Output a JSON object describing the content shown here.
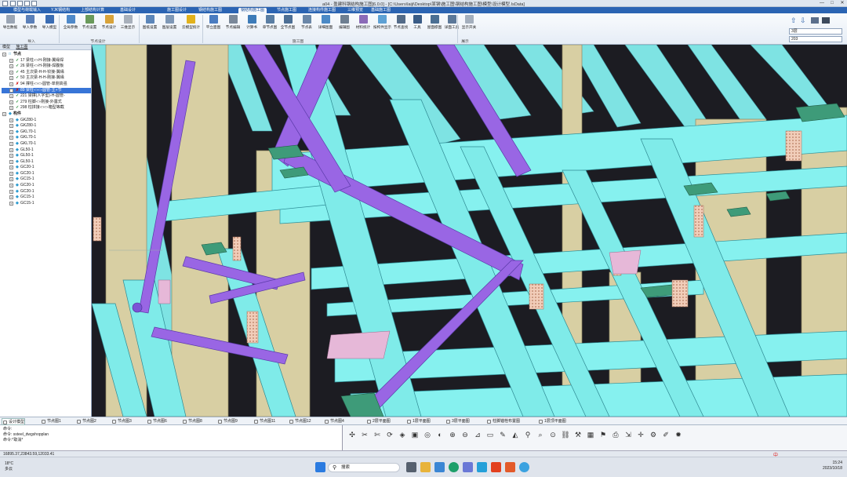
{
  "window": {
    "title": "a04 - 盈建科钢结构施工图[6.0.0] - [C:\\Users\\laiji\\Desktop\\某钢\\施工图\\钢结构施工图\\模型\\设计模型.IsData]",
    "minimize": "—",
    "maximize": "□",
    "close": "✕"
  },
  "ribbon_tabs": [
    "模型与荷载输入",
    "YJK钢结构",
    "上部结构计算",
    "基础设计",
    "施工图设计",
    "钢结构施工图",
    "钢结构施工图",
    "节点施工图",
    "连接构件施工图",
    "三维预览",
    "基础施工图"
  ],
  "active_tab_index": 6,
  "ribbon": {
    "buttons": [
      {
        "label": "导出数据",
        "icon": "export-icon",
        "color": "#9aa5b4"
      },
      {
        "label": "导入参数",
        "icon": "import-params-icon",
        "color": "#5a7fb8"
      },
      {
        "label": "导入模型",
        "icon": "import-model-icon",
        "color": "#3b6db3"
      },
      {
        "label": "全局参数",
        "icon": "global-params-icon",
        "color": "#4f89c9"
      },
      {
        "label": "节点设置",
        "icon": "node-settings-icon",
        "color": "#6a9a5b"
      },
      {
        "label": "节点设计",
        "icon": "node-design-icon",
        "color": "#d8a33a"
      },
      {
        "label": "三维显示",
        "icon": "3d-display-icon",
        "color": "#a8b0bb"
      },
      {
        "label": "图纸设置",
        "icon": "drawing-settings-icon",
        "color": "#5c86b9"
      },
      {
        "label": "图层设置",
        "icon": "layer-settings-icon",
        "color": "#7f98b6"
      },
      {
        "label": "云模型统计",
        "icon": "cloud-stats-icon",
        "color": "#e2b21c"
      },
      {
        "label": "平立面图",
        "icon": "plan-elevation-icon",
        "color": "#4a7cc0"
      },
      {
        "label": "节点编辑",
        "icon": "node-edit-icon",
        "color": "#7a8899"
      },
      {
        "label": "计算书",
        "icon": "calc-book-icon",
        "color": "#3d7bb8"
      },
      {
        "label": "单节点图",
        "icon": "single-node-icon",
        "color": "#5a7ea3"
      },
      {
        "label": "全节点图",
        "icon": "all-nodes-icon",
        "color": "#4d6f95"
      },
      {
        "label": "节点表",
        "icon": "node-table-icon",
        "color": "#6b87a8"
      },
      {
        "label": "详细图面",
        "icon": "detail-view-icon",
        "color": "#4c8ac6"
      },
      {
        "label": "编辑图",
        "icon": "edit-drawing-icon",
        "color": "#6e7f91"
      },
      {
        "label": "材料统计",
        "icon": "material-stats-icon",
        "color": "#8b6bb8"
      },
      {
        "label": "按构件显示",
        "icon": "by-member-icon",
        "color": "#5ea1d4"
      },
      {
        "label": "节点查找",
        "icon": "node-search-icon",
        "color": "#536b88"
      },
      {
        "label": "工具",
        "icon": "tools-icon",
        "color": "#3a5c86"
      },
      {
        "label": "屋面檩图",
        "icon": "roof-purlin-icon",
        "color": "#4b6f93"
      },
      {
        "label": "详面工具",
        "icon": "detail-tools-icon",
        "color": "#5b7899"
      },
      {
        "label": "显示开关",
        "icon": "display-switch-icon",
        "color": "#a4afbd"
      }
    ],
    "groups": [
      "导入",
      "节点设计",
      "施工图",
      "展示"
    ],
    "right_controls": {
      "floor": "3层",
      "number": "203",
      "up": "⇧",
      "down": "⇩"
    }
  },
  "left_panel": {
    "tabs": [
      "模型",
      "施工图"
    ],
    "tree": [
      {
        "level": 0,
        "mark": "□",
        "text": "节点",
        "bold": true
      },
      {
        "level": 1,
        "mark": "✓",
        "text": "17 梁柱-□-H-刚接-翼缘焊"
      },
      {
        "level": 1,
        "mark": "✓",
        "text": "26 梁柱-□-H-刚接-焊腹板"
      },
      {
        "level": 1,
        "mark": "✓",
        "text": "45 主次梁-H-H-铰接-翼缘"
      },
      {
        "level": 1,
        "mark": "✓",
        "text": "50 主次梁-H-H-刚接-翼缘"
      },
      {
        "level": 1,
        "mark": "✗",
        "text": "94 撑柱-□-□-圆管-单侧高强"
      },
      {
        "level": 1,
        "mark": "✗",
        "text": "89 梁柱-□-□-圆管-主+节",
        "selected": true
      },
      {
        "level": 1,
        "mark": "✓",
        "text": "221 梁撑(人字型)-H-圆管-"
      },
      {
        "level": 1,
        "mark": "✓",
        "text": "279 柱脚-□-刚接-外露式"
      },
      {
        "level": 1,
        "mark": "✓",
        "text": "298 柱拼接-□-□-箱型等截"
      },
      {
        "level": 0,
        "mark": "◆",
        "text": "构件",
        "bold": true
      },
      {
        "level": 1,
        "mark": "◆",
        "text": "GKZ80-1"
      },
      {
        "level": 1,
        "mark": "◆",
        "text": "GKZ80-1"
      },
      {
        "level": 1,
        "mark": "◆",
        "text": "GKL70-1"
      },
      {
        "level": 1,
        "mark": "◆",
        "text": "GKL70-1"
      },
      {
        "level": 1,
        "mark": "◆",
        "text": "GKL70-1"
      },
      {
        "level": 1,
        "mark": "◆",
        "text": "GL50-1"
      },
      {
        "level": 1,
        "mark": "◆",
        "text": "GL50-1"
      },
      {
        "level": 1,
        "mark": "◆",
        "text": "GL50-1"
      },
      {
        "level": 1,
        "mark": "◆",
        "text": "GC20-1"
      },
      {
        "level": 1,
        "mark": "◆",
        "text": "GC20-1"
      },
      {
        "level": 1,
        "mark": "◆",
        "text": "GC15-1"
      },
      {
        "level": 1,
        "mark": "◆",
        "text": "GC20-1"
      },
      {
        "level": 1,
        "mark": "◆",
        "text": "GC20-1"
      },
      {
        "level": 1,
        "mark": "◆",
        "text": "GC15-1"
      },
      {
        "level": 1,
        "mark": "◆",
        "text": "GC15-1"
      }
    ]
  },
  "bottom_tabs": [
    "设计模型",
    "节点图1",
    "节点图2",
    "节点图3",
    "节点图6",
    "节点图8",
    "节点图9",
    "节点图11",
    "节点图12",
    "节点图4",
    "2层平面图",
    "1层平面图",
    "3层平面图",
    "柱脚锚栓布置图",
    "1层顶平面图"
  ],
  "active_bottom_tab": 0,
  "command": {
    "lines": [
      "命令:",
      "命令: ssteel_dwgshopplan",
      "命令:*取消*"
    ]
  },
  "status": {
    "coords": "16895.37,23843.59,12033.41"
  },
  "taskbar": {
    "weather_temp": "18°C",
    "weather_text": "多云",
    "search_placeholder": "搜索",
    "time": "15:24",
    "date": "2023/10/18",
    "ime": "中"
  },
  "colors": {
    "steel_cyan": "#84f0ee",
    "brace_purple": "#9a68e6",
    "column_tan": "#d6cda1",
    "plate_green": "#3f9c7a",
    "bolt_plate": "#efc9b8",
    "background": "#1c1c22"
  }
}
